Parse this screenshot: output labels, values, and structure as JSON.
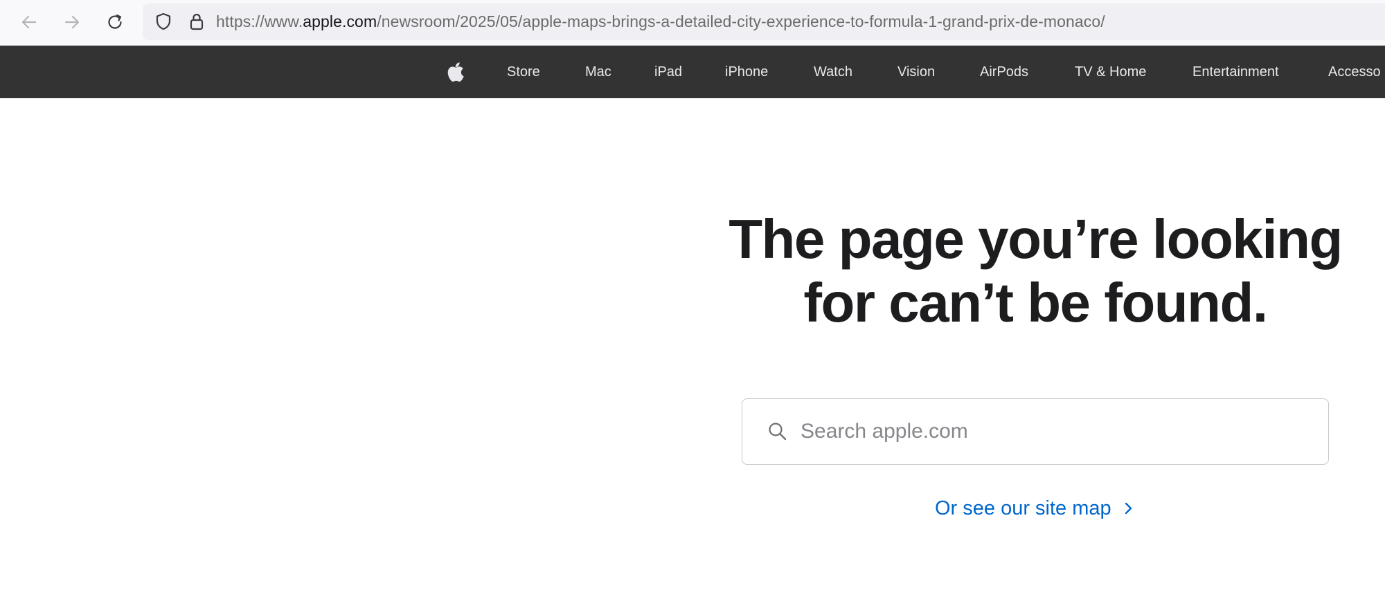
{
  "browser": {
    "url_prefix": "https://www.",
    "url_domain": "apple.com",
    "url_path": "/newsroom/2025/05/apple-maps-brings-a-detailed-city-experience-to-formula-1-grand-prix-de-monaco/",
    "icons": {
      "back": "arrow-left-icon",
      "forward": "arrow-right-icon",
      "reload": "reload-icon",
      "tracking_protection": "shield-icon",
      "secure": "lock-icon"
    }
  },
  "global_nav": {
    "logo": "apple-logo-icon",
    "items": [
      {
        "label": "Store"
      },
      {
        "label": "Mac"
      },
      {
        "label": "iPad"
      },
      {
        "label": "iPhone"
      },
      {
        "label": "Watch"
      },
      {
        "label": "Vision"
      },
      {
        "label": "AirPods"
      },
      {
        "label": "TV & Home"
      },
      {
        "label": "Entertainment"
      },
      {
        "label": "Accesso"
      }
    ]
  },
  "main": {
    "headline_line1": "The page you’re looking",
    "headline_line2": "for can’t be found.",
    "search": {
      "placeholder": "Search apple.com",
      "value": ""
    },
    "sitemap_link": "Or see our site map"
  },
  "colors": {
    "nav_background": "#333333",
    "link": "#0066cc",
    "headline": "#1d1d1f"
  }
}
